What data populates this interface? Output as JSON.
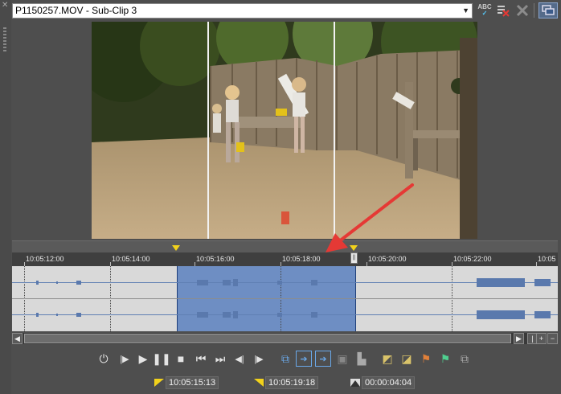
{
  "window": {
    "clip_title": "P1150257.MOV - Sub-Clip 3",
    "spell_label_top": "ABC",
    "spell_label_bottom": "✓"
  },
  "icons": {
    "close": "close-icon",
    "spellcheck": "spellcheck-icon",
    "clear_markers": "clear-markers-icon",
    "delete": "delete-icon",
    "monitor": "external-monitor-icon"
  },
  "timeline": {
    "ticks": [
      "10:05:12:00",
      "10:05:14:00",
      "10:05:16:00",
      "10:05:18:00",
      "10:05:20:00",
      "10:05:22:00",
      "10:05"
    ],
    "out_handle_label": "||"
  },
  "transport": {
    "buttons": [
      "loop",
      "play-from-start",
      "play",
      "pause",
      "stop",
      "go-to-start",
      "go-to-end",
      "previous-frame",
      "next-frame",
      "create-subclip",
      "mark-in",
      "mark-out",
      "add-marker",
      "clear-selection",
      "region-in",
      "region-out",
      "insert-marker",
      "insert-region",
      "snapshot"
    ]
  },
  "times": {
    "in_point": "10:05:15:13",
    "out_point": "10:05:19:18",
    "duration": "00:00:04:04"
  },
  "colors": {
    "selection": "#6e8ec3",
    "background": "#4e4e4e",
    "marker_flag": "#f2d21b",
    "annotation_arrow": "#e53935"
  }
}
